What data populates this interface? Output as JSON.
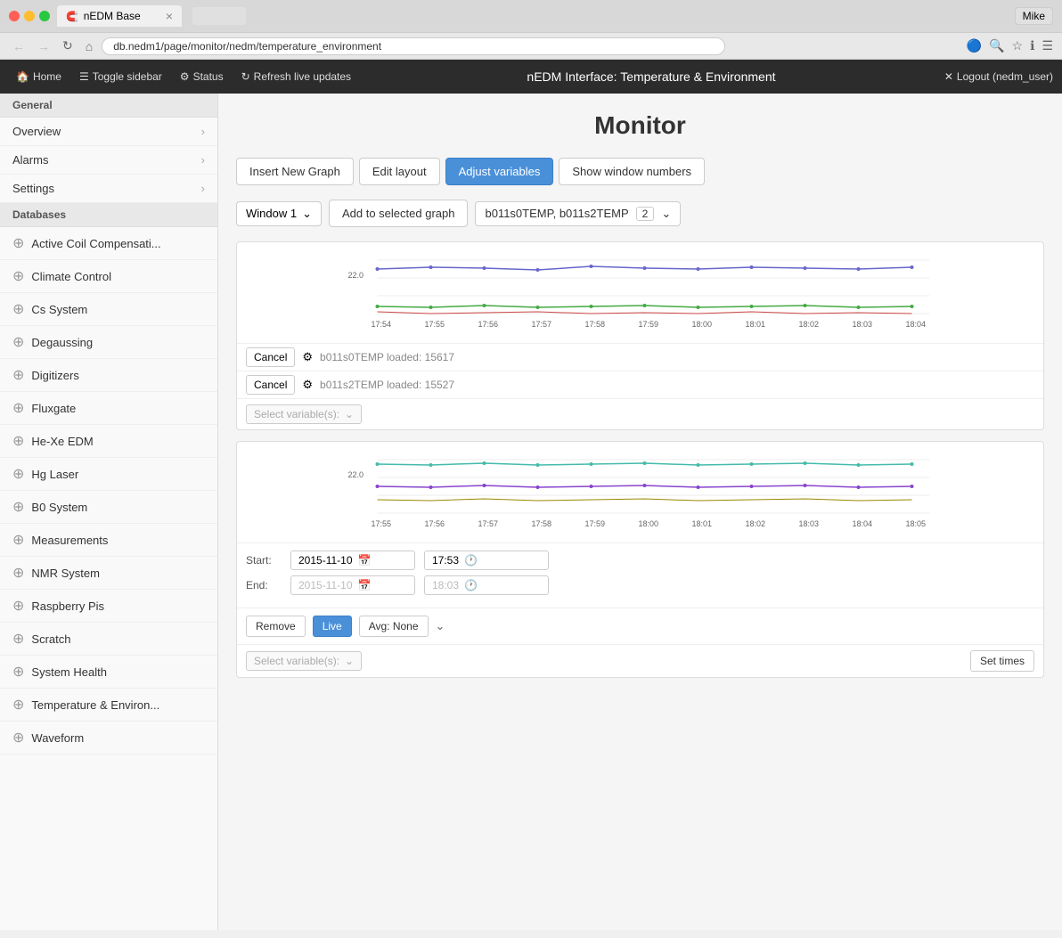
{
  "browser": {
    "tab_title": "nEDM Base",
    "tab_icon": "🧲",
    "url": "db.nedm1/page/monitor/nedm/temperature_environment",
    "user": "Mike"
  },
  "app_header": {
    "home_label": "Home",
    "toggle_sidebar_label": "Toggle sidebar",
    "status_label": "Status",
    "refresh_label": "Refresh live updates",
    "title": "nEDM Interface: Temperature & Environment",
    "logout_label": "Logout (nedm_user)"
  },
  "sidebar": {
    "general_header": "General",
    "general_items": [
      {
        "label": "Overview",
        "id": "overview"
      },
      {
        "label": "Alarms",
        "id": "alarms"
      },
      {
        "label": "Settings",
        "id": "settings"
      }
    ],
    "databases_header": "Databases",
    "db_items": [
      {
        "label": "Active Coil Compensati...",
        "id": "active-coil"
      },
      {
        "label": "Climate Control",
        "id": "climate-control"
      },
      {
        "label": "Cs System",
        "id": "cs-system"
      },
      {
        "label": "Degaussing",
        "id": "degaussing"
      },
      {
        "label": "Digitizers",
        "id": "digitizers"
      },
      {
        "label": "Fluxgate",
        "id": "fluxgate"
      },
      {
        "label": "He-Xe EDM",
        "id": "he-xe-edm"
      },
      {
        "label": "Hg Laser",
        "id": "hg-laser"
      },
      {
        "label": "B0 System",
        "id": "b0-system"
      },
      {
        "label": "Measurements",
        "id": "measurements"
      },
      {
        "label": "NMR System",
        "id": "nmr-system"
      },
      {
        "label": "Raspberry Pis",
        "id": "raspberry-pis"
      },
      {
        "label": "Scratch",
        "id": "scratch"
      },
      {
        "label": "System Health",
        "id": "system-health"
      },
      {
        "label": "Temperature & Environ...",
        "id": "temperature-environ"
      },
      {
        "label": "Waveform",
        "id": "waveform"
      }
    ]
  },
  "main": {
    "page_title": "Monitor",
    "toolbar": {
      "insert_new_graph": "Insert New Graph",
      "edit_layout": "Edit layout",
      "adjust_variables": "Adjust variables",
      "show_window_numbers": "Show window numbers"
    },
    "window_selector": {
      "window_label": "Window 1",
      "add_to_graph": "Add to selected graph",
      "variables": "b011s0TEMP, b011s2TEMP",
      "count": "2"
    },
    "graph1": {
      "y_label": "22.0",
      "x_labels": [
        "17:54",
        "17:55",
        "17:56",
        "17:57",
        "17:58",
        "17:59",
        "18:00",
        "18:01",
        "18:02",
        "18:03",
        "18:04"
      ],
      "cancel1_label": "Cancel",
      "cancel1_info": "b011s0TEMP loaded: 15617",
      "cancel2_label": "Cancel",
      "cancel2_info": "b011s2TEMP loaded: 15527",
      "select_vars_placeholder": "Select variable(s):"
    },
    "graph2": {
      "y_label": "22.0",
      "x_labels": [
        "17:55",
        "17:56",
        "17:57",
        "17:58",
        "17:59",
        "18:00",
        "18:01",
        "18:02",
        "18:03",
        "18:04",
        "18:05"
      ],
      "start_label": "Start:",
      "end_label": "End:",
      "start_date": "2015-11-10",
      "start_time": "17:53",
      "end_date": "2015-11-10",
      "end_time": "18:03",
      "remove_label": "Remove",
      "live_label": "Live",
      "avg_label": "Avg: None",
      "set_times_label": "Set times",
      "select_vars_placeholder": "Select variable(s):"
    }
  }
}
